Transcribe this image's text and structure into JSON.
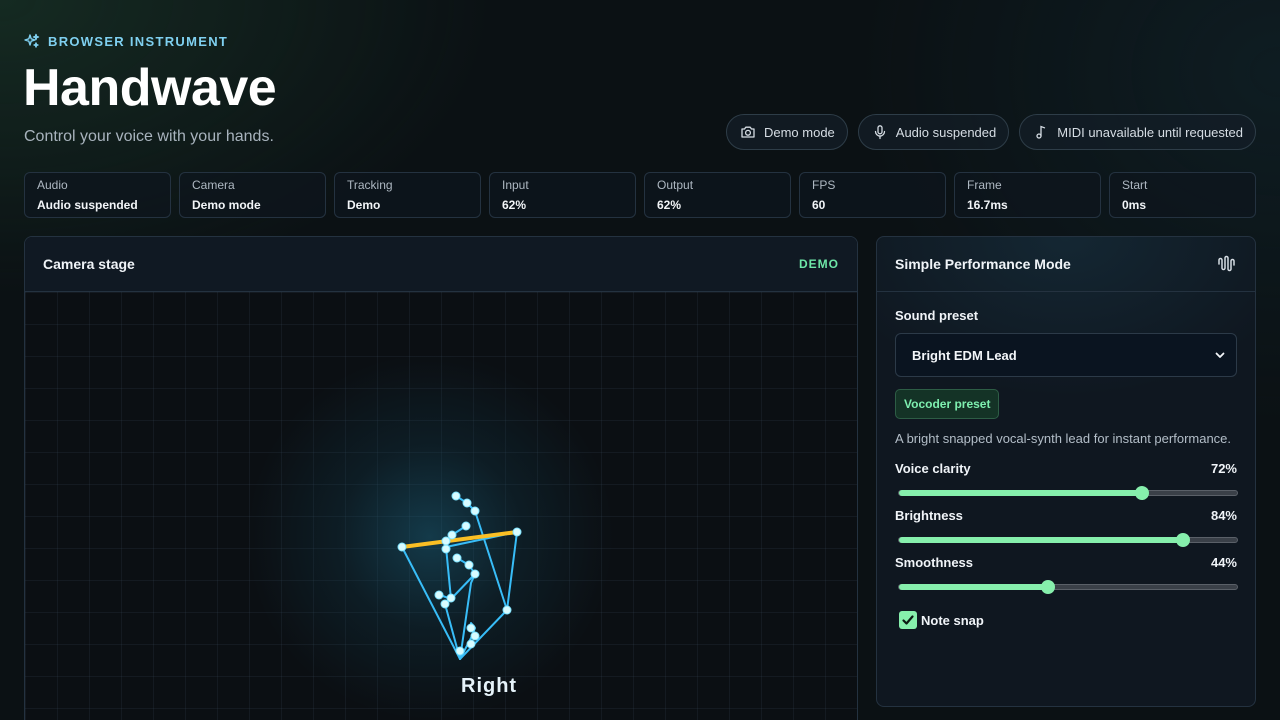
{
  "header": {
    "eyebrow": "BROWSER INSTRUMENT",
    "eyebrow_icon": "sparkles-icon",
    "title": "Handwave",
    "subtitle": "Control your voice with your hands."
  },
  "pills": [
    {
      "icon": "camera-icon",
      "label": "Demo mode"
    },
    {
      "icon": "microphone-icon",
      "label": "Audio suspended"
    },
    {
      "icon": "music-note-icon",
      "label": "MIDI unavailable until requested"
    }
  ],
  "stats": [
    {
      "label": "Audio",
      "value": "Audio suspended"
    },
    {
      "label": "Camera",
      "value": "Demo mode"
    },
    {
      "label": "Tracking",
      "value": "Demo"
    },
    {
      "label": "Input",
      "value": "62%"
    },
    {
      "label": "Output",
      "value": "62%"
    },
    {
      "label": "FPS",
      "value": "60"
    },
    {
      "label": "Frame",
      "value": "16.7ms"
    },
    {
      "label": "Start",
      "value": "0ms"
    }
  ],
  "stage": {
    "title": "Camera stage",
    "badge": "DEMO",
    "hand_label": "Right"
  },
  "panel": {
    "title": "Simple Performance Mode",
    "icon": "waveform-icon",
    "preset_label": "Sound preset",
    "preset_value": "Bright EDM Lead",
    "tag": "Vocoder preset",
    "description": "A bright snapped vocal-synth lead for instant performance.",
    "sliders": [
      {
        "label": "Voice clarity",
        "value": "72%",
        "level": 0.72
      },
      {
        "label": "Brightness",
        "value": "84%",
        "level": 0.84
      },
      {
        "label": "Smoothness",
        "value": "44%",
        "level": 0.44
      }
    ],
    "checkbox_label": "Note snap",
    "checkbox_checked": true
  },
  "colors": {
    "accent": "#86efac",
    "skeleton": "#38bdf8",
    "pinch_line": "#fbbf24",
    "eyebrow": "#7fd0f0"
  }
}
